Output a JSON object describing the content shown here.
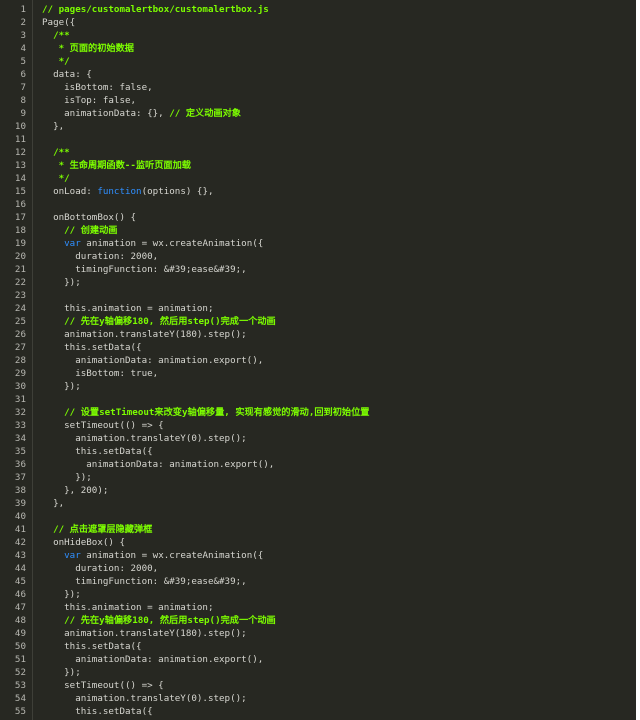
{
  "editor": {
    "lines": [
      {
        "n": "1",
        "segments": [
          {
            "t": "// pages/customalertbox/customalertbox.js",
            "c": "comment"
          }
        ]
      },
      {
        "n": "2",
        "segments": [
          {
            "t": "Page({",
            "c": ""
          }
        ]
      },
      {
        "n": "3",
        "segments": [
          {
            "t": "  /**",
            "c": "comment"
          }
        ]
      },
      {
        "n": "4",
        "segments": [
          {
            "t": "   * 页面的初始数据",
            "c": "comment"
          }
        ]
      },
      {
        "n": "5",
        "segments": [
          {
            "t": "   */",
            "c": "comment"
          }
        ]
      },
      {
        "n": "6",
        "segments": [
          {
            "t": "  data: {",
            "c": ""
          }
        ]
      },
      {
        "n": "7",
        "segments": [
          {
            "t": "    isBottom: false,",
            "c": ""
          }
        ]
      },
      {
        "n": "8",
        "segments": [
          {
            "t": "    isTop: false,",
            "c": ""
          }
        ]
      },
      {
        "n": "9",
        "segments": [
          {
            "t": "    animationData: {}, ",
            "c": ""
          },
          {
            "t": "// 定义动画对象",
            "c": "comment"
          }
        ]
      },
      {
        "n": "10",
        "segments": [
          {
            "t": "  },",
            "c": ""
          }
        ]
      },
      {
        "n": "11",
        "segments": [
          {
            "t": "",
            "c": ""
          }
        ]
      },
      {
        "n": "12",
        "segments": [
          {
            "t": "  /**",
            "c": "comment"
          }
        ]
      },
      {
        "n": "13",
        "segments": [
          {
            "t": "   * 生命周期函数--监听页面加载",
            "c": "comment"
          }
        ]
      },
      {
        "n": "14",
        "segments": [
          {
            "t": "   */",
            "c": "comment"
          }
        ]
      },
      {
        "n": "15",
        "segments": [
          {
            "t": "  onLoad: ",
            "c": ""
          },
          {
            "t": "function",
            "c": "kw"
          },
          {
            "t": "(options) {},",
            "c": ""
          }
        ]
      },
      {
        "n": "16",
        "segments": [
          {
            "t": "",
            "c": ""
          }
        ]
      },
      {
        "n": "17",
        "segments": [
          {
            "t": "  onBottomBox() {",
            "c": ""
          }
        ]
      },
      {
        "n": "18",
        "segments": [
          {
            "t": "    // 创建动画",
            "c": "comment"
          }
        ]
      },
      {
        "n": "19",
        "segments": [
          {
            "t": "    ",
            "c": ""
          },
          {
            "t": "var",
            "c": "kw"
          },
          {
            "t": " animation = wx.createAnimation({",
            "c": ""
          }
        ]
      },
      {
        "n": "20",
        "segments": [
          {
            "t": "      duration: 2000,",
            "c": ""
          }
        ]
      },
      {
        "n": "21",
        "segments": [
          {
            "t": "      timingFunction: &#39;ease&#39;,",
            "c": ""
          }
        ]
      },
      {
        "n": "22",
        "segments": [
          {
            "t": "    });",
            "c": ""
          }
        ]
      },
      {
        "n": "23",
        "segments": [
          {
            "t": "",
            "c": ""
          }
        ]
      },
      {
        "n": "24",
        "segments": [
          {
            "t": "    this.animation = animation;",
            "c": ""
          }
        ]
      },
      {
        "n": "25",
        "segments": [
          {
            "t": "    // 先在y轴偏移180, 然后用step()完成一个动画",
            "c": "comment"
          }
        ]
      },
      {
        "n": "26",
        "segments": [
          {
            "t": "    animation.translateY(180).step();",
            "c": ""
          }
        ]
      },
      {
        "n": "27",
        "segments": [
          {
            "t": "    this.setData({",
            "c": ""
          }
        ]
      },
      {
        "n": "28",
        "segments": [
          {
            "t": "      animationData: animation.export(),",
            "c": ""
          }
        ]
      },
      {
        "n": "29",
        "segments": [
          {
            "t": "      isBottom: true,",
            "c": ""
          }
        ]
      },
      {
        "n": "30",
        "segments": [
          {
            "t": "    });",
            "c": ""
          }
        ]
      },
      {
        "n": "31",
        "segments": [
          {
            "t": "",
            "c": ""
          }
        ]
      },
      {
        "n": "32",
        "segments": [
          {
            "t": "    // 设置setTimeout来改变y轴偏移量, 实现有感觉的滑动,回到初始位置",
            "c": "comment"
          }
        ]
      },
      {
        "n": "33",
        "segments": [
          {
            "t": "    setTimeout(() => {",
            "c": ""
          }
        ]
      },
      {
        "n": "34",
        "segments": [
          {
            "t": "      animation.translateY(0).step();",
            "c": ""
          }
        ]
      },
      {
        "n": "35",
        "segments": [
          {
            "t": "      this.setData({",
            "c": ""
          }
        ]
      },
      {
        "n": "36",
        "segments": [
          {
            "t": "        animationData: animation.export(),",
            "c": ""
          }
        ]
      },
      {
        "n": "37",
        "segments": [
          {
            "t": "      });",
            "c": ""
          }
        ]
      },
      {
        "n": "38",
        "segments": [
          {
            "t": "    }, 200);",
            "c": ""
          }
        ]
      },
      {
        "n": "39",
        "segments": [
          {
            "t": "  },",
            "c": ""
          }
        ]
      },
      {
        "n": "40",
        "segments": [
          {
            "t": "",
            "c": ""
          }
        ]
      },
      {
        "n": "41",
        "segments": [
          {
            "t": "  // 点击遮罩层隐藏弹框",
            "c": "comment"
          }
        ]
      },
      {
        "n": "42",
        "segments": [
          {
            "t": "  onHideBox() {",
            "c": ""
          }
        ]
      },
      {
        "n": "43",
        "segments": [
          {
            "t": "    ",
            "c": ""
          },
          {
            "t": "var",
            "c": "kw"
          },
          {
            "t": " animation = wx.createAnimation({",
            "c": ""
          }
        ]
      },
      {
        "n": "44",
        "segments": [
          {
            "t": "      duration: 2000,",
            "c": ""
          }
        ]
      },
      {
        "n": "45",
        "segments": [
          {
            "t": "      timingFunction: &#39;ease&#39;,",
            "c": ""
          }
        ]
      },
      {
        "n": "46",
        "segments": [
          {
            "t": "    });",
            "c": ""
          }
        ]
      },
      {
        "n": "47",
        "segments": [
          {
            "t": "    this.animation = animation;",
            "c": ""
          }
        ]
      },
      {
        "n": "48",
        "segments": [
          {
            "t": "    // 先在y轴偏移180, 然后用step()完成一个动画",
            "c": "comment"
          }
        ]
      },
      {
        "n": "49",
        "segments": [
          {
            "t": "    animation.translateY(180).step();",
            "c": ""
          }
        ]
      },
      {
        "n": "50",
        "segments": [
          {
            "t": "    this.setData({",
            "c": ""
          }
        ]
      },
      {
        "n": "51",
        "segments": [
          {
            "t": "      animationData: animation.export(),",
            "c": ""
          }
        ]
      },
      {
        "n": "52",
        "segments": [
          {
            "t": "    });",
            "c": ""
          }
        ]
      },
      {
        "n": "53",
        "segments": [
          {
            "t": "    setTimeout(() => {",
            "c": ""
          }
        ]
      },
      {
        "n": "54",
        "segments": [
          {
            "t": "      animation.translateY(0).step();",
            "c": ""
          }
        ]
      },
      {
        "n": "55",
        "segments": [
          {
            "t": "      this.setData({",
            "c": ""
          }
        ]
      }
    ]
  }
}
